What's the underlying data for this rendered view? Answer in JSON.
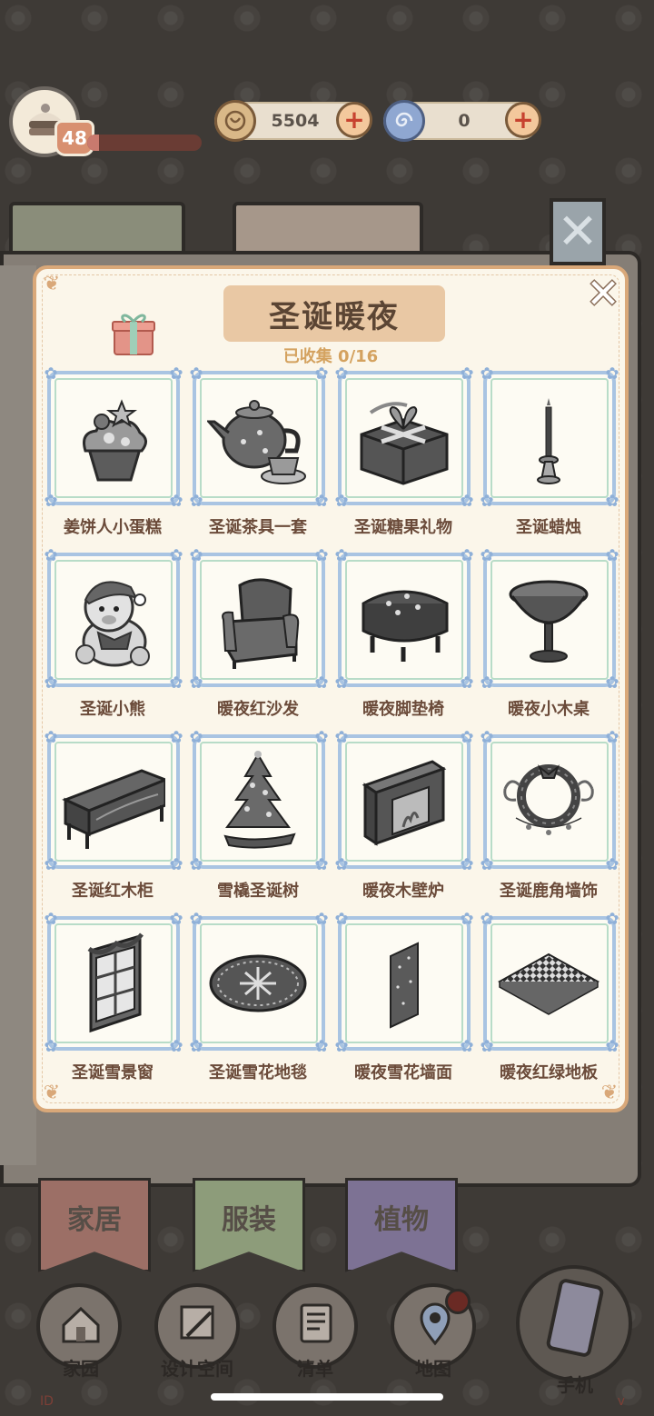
{
  "hud": {
    "level": "48",
    "xp_progress": 0.1,
    "coins": "5504",
    "gems": "0"
  },
  "tabs": [
    {
      "label": "家居",
      "color": "#9c6f66"
    },
    {
      "label": "服装",
      "color": "#8d9c7a"
    },
    {
      "label": "植物",
      "color": "#7d7294"
    }
  ],
  "nav": [
    {
      "label": "家园",
      "icon": "home-icon"
    },
    {
      "label": "设计空间",
      "icon": "design-icon"
    },
    {
      "label": "清单",
      "icon": "checklist-icon"
    },
    {
      "label": "地图",
      "icon": "map-pin-icon"
    },
    {
      "label": "手机",
      "icon": "phone-icon"
    }
  ],
  "footer": {
    "id_text": "ID",
    "version_text": "v"
  },
  "modal": {
    "title": "圣诞暖夜",
    "collected_label": "已收集 0/16",
    "items": [
      {
        "name": "姜饼人小蛋糕",
        "icon": "cupcake-icon"
      },
      {
        "name": "圣诞茶具一套",
        "icon": "teapot-icon"
      },
      {
        "name": "圣诞糖果礼物",
        "icon": "gift-box-icon"
      },
      {
        "name": "圣诞蜡烛",
        "icon": "candle-icon"
      },
      {
        "name": "圣诞小熊",
        "icon": "teddy-bear-icon"
      },
      {
        "name": "暖夜红沙发",
        "icon": "armchair-icon"
      },
      {
        "name": "暖夜脚垫椅",
        "icon": "ottoman-icon"
      },
      {
        "name": "暖夜小木桌",
        "icon": "round-table-icon"
      },
      {
        "name": "圣诞红木柜",
        "icon": "cabinet-icon"
      },
      {
        "name": "雪橇圣诞树",
        "icon": "christmas-tree-icon"
      },
      {
        "name": "暖夜木壁炉",
        "icon": "fireplace-icon"
      },
      {
        "name": "圣诞鹿角墙饰",
        "icon": "wreath-icon"
      },
      {
        "name": "圣诞雪景窗",
        "icon": "window-icon"
      },
      {
        "name": "圣诞雪花地毯",
        "icon": "rug-icon"
      },
      {
        "name": "暖夜雪花墙面",
        "icon": "wall-panel-icon"
      },
      {
        "name": "暖夜红绿地板",
        "icon": "floor-tile-icon"
      }
    ]
  }
}
